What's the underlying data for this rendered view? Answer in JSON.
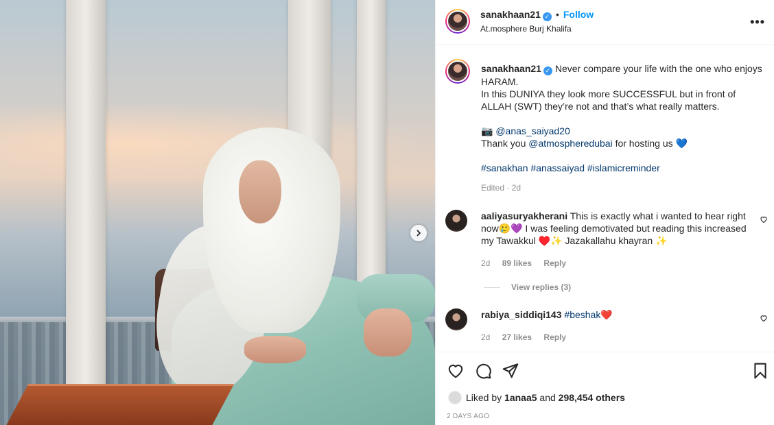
{
  "post": {
    "username": "sanakhaan21",
    "follow_label": "Follow",
    "separator": "•",
    "location": "At.mosphere Burj Khalifa"
  },
  "caption": {
    "username": "sanakhaan21",
    "line1": "Never compare your life with the one who enjoys HARAM.",
    "line2": "In this DUNIYA they look more SUCCESSFUL but in front of ALLAH (SWT) they’re not and that’s what really matters.",
    "camera_emoji": "📷",
    "photographer": "@anas_saiyad20",
    "thanks_prefix": "Thank you",
    "thanks_mention": "@atmospheredubai",
    "thanks_suffix": "for hosting us",
    "thanks_emoji": "💙",
    "hashtags": [
      "#sanakhan",
      "#anassaiyad",
      "#islamicreminder"
    ],
    "edited": "Edited · 2d"
  },
  "comments": [
    {
      "username": "aaliyasuryakherani",
      "text": "This is exactly what i wanted to hear right now🥲💜 I was feeling demotivated but reading this increased my Tawakkul ♥️✨ Jazakallahu khayran ✨",
      "age": "2d",
      "likes": "89 likes",
      "reply": "Reply",
      "view_replies": "View replies (3)"
    },
    {
      "username": "rabiya_siddiqi143",
      "text_tag": "#beshak",
      "text_emoji": "❤️",
      "age": "2d",
      "likes": "27 likes",
      "reply": "Reply"
    }
  ],
  "footer": {
    "liked_by_prefix": "Liked by",
    "liked_by_user": "1anaa5",
    "liked_by_and": "and",
    "liked_by_count": "298,454 others",
    "time_ago": "2 DAYS AGO"
  },
  "icons": {
    "more": "more-icon",
    "like": "heart-icon",
    "comment": "comment-icon",
    "share": "send-icon",
    "save": "bookmark-icon",
    "next": "chevron-right-icon"
  },
  "colors": {
    "accent": "#0095f6",
    "mention": "#00376b",
    "muted": "#8e8e8e",
    "verified": "#3897f0"
  }
}
